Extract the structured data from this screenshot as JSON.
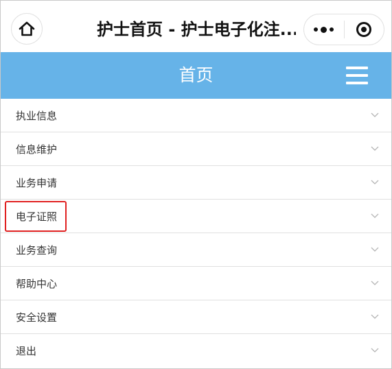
{
  "titlebar": {
    "title": "护士首页 - 护士电子化注...",
    "home_icon": "home-icon",
    "more_icon": "more-dots-icon",
    "close_icon": "target-close-icon"
  },
  "header": {
    "title": "首页",
    "menu_icon": "hamburger-menu-icon",
    "background": "#66b3e8"
  },
  "menu": {
    "items": [
      {
        "label": "执业信息"
      },
      {
        "label": "信息维护"
      },
      {
        "label": "业务申请"
      },
      {
        "label": "电子证照",
        "highlighted": true
      },
      {
        "label": "业务查询"
      },
      {
        "label": "帮助中心"
      },
      {
        "label": "安全设置"
      },
      {
        "label": "退出"
      }
    ],
    "chevron_icon": "chevron-down-icon",
    "highlight_color": "#e02020"
  }
}
